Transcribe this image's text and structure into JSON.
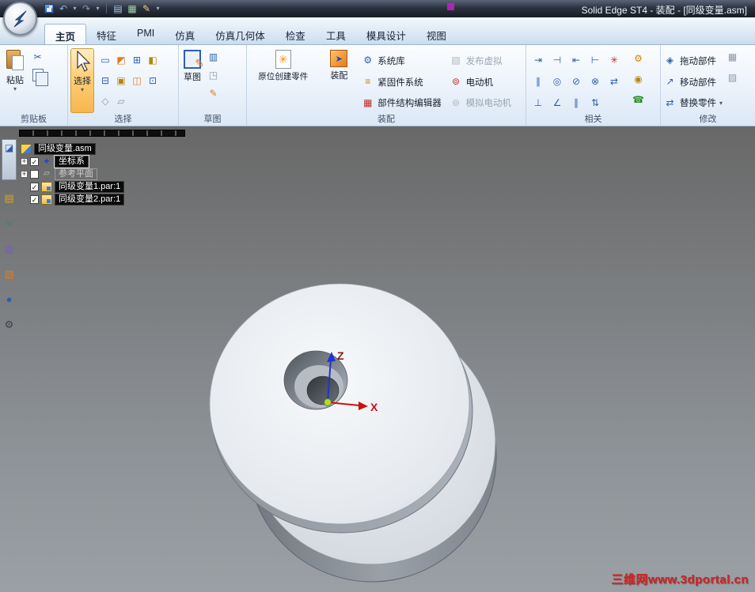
{
  "window": {
    "title": "Solid Edge ST4 - 装配 - [同级变量.asm]"
  },
  "tabs": [
    {
      "label": "主页",
      "active": true
    },
    {
      "label": "特征"
    },
    {
      "label": "PMI"
    },
    {
      "label": "仿真"
    },
    {
      "label": "仿真几何体"
    },
    {
      "label": "检查"
    },
    {
      "label": "工具"
    },
    {
      "label": "模具设计"
    },
    {
      "label": "视图"
    }
  ],
  "ribbon": {
    "clipboard": {
      "group_label": "剪贴板",
      "paste": "粘贴"
    },
    "select": {
      "group_label": "选择",
      "select": "选择"
    },
    "sketch": {
      "group_label": "草图",
      "sketch": "草图"
    },
    "assemble": {
      "group_label": "装配",
      "create_in_place": "原位创建零件",
      "assemble_label": "装配",
      "system_library": "系统库",
      "fastener_system": "紧固件系统",
      "structure_editor": "部件结构编辑器",
      "publish_virtual": "发布虚拟",
      "motor": "电动机",
      "simulate_motor": "模拟电动机"
    },
    "relate": {
      "group_label": "相关"
    },
    "modify": {
      "group_label": "修改",
      "drag": "拖动部件",
      "move": "移动部件",
      "replace": "替换零件"
    }
  },
  "pathfinder": {
    "root": "同级变量.asm",
    "items": [
      {
        "label": "坐标系",
        "checked": true
      },
      {
        "label": "参考平面",
        "checked": false
      },
      {
        "label": "同级变量1.par:1",
        "checked": true
      },
      {
        "label": "同级变量2.par:1",
        "checked": true
      }
    ]
  },
  "viewport": {
    "axis_z": "Z",
    "axis_x": "X",
    "watermark": "三维网www.3dportal.cn"
  },
  "colors": {
    "selected_tool_accent": "#f7b64e",
    "viewport_top": "#686868",
    "viewport_bottom": "#9ba0a5",
    "watermark_red": "#d22222",
    "axis_x_red": "#cc1111",
    "axis_z_blue": "#2233cc",
    "origin_green": "#b8d832"
  },
  "glyphs": {
    "caret": "▾",
    "undo": "↶",
    "redo": "↷",
    "doc": "▤",
    "grid": "▦",
    "pencil": "✎",
    "cut": "✂",
    "gear": "⚙",
    "fastener": "≡",
    "structure": "▦",
    "virtual": "▧",
    "motor": "⊚",
    "star": "✳",
    "arrow": "➤",
    "drag": "◈",
    "move": "↗",
    "replace": "⇄",
    "check": "✓",
    "plus": "+",
    "axes": "+",
    "planes": "▱",
    "sel1": "▭",
    "sel2": "◩",
    "sel3": "⊞",
    "sel4": "◧",
    "sel5": "⊟",
    "sel6": "▣",
    "sel7": "◫",
    "sel8": "⊡",
    "sel9": "◇",
    "sel10": "▱",
    "sk1": "▥",
    "sk2": "◳",
    "sk3": "✎",
    "r11": "⇥",
    "r12": "⊣",
    "r13": "⇤",
    "r14": "⊢",
    "r15": "✳",
    "r21": "∥",
    "r22": "◎",
    "r23": "⊘",
    "r24": "⊗",
    "r25": "⇄",
    "r31": "⊥",
    "r32": "∠",
    "r33": "∥",
    "r34": "⇅",
    "rc1": "⚙",
    "rc2": "◉",
    "rc3": "☎",
    "m1": "▦",
    "m2": "▨",
    "eb0": "◪",
    "eb1": "▤",
    "eb2": "≡",
    "eb3": "▥",
    "eb4": "▧",
    "eb5": "●",
    "eb6": "⚙"
  }
}
